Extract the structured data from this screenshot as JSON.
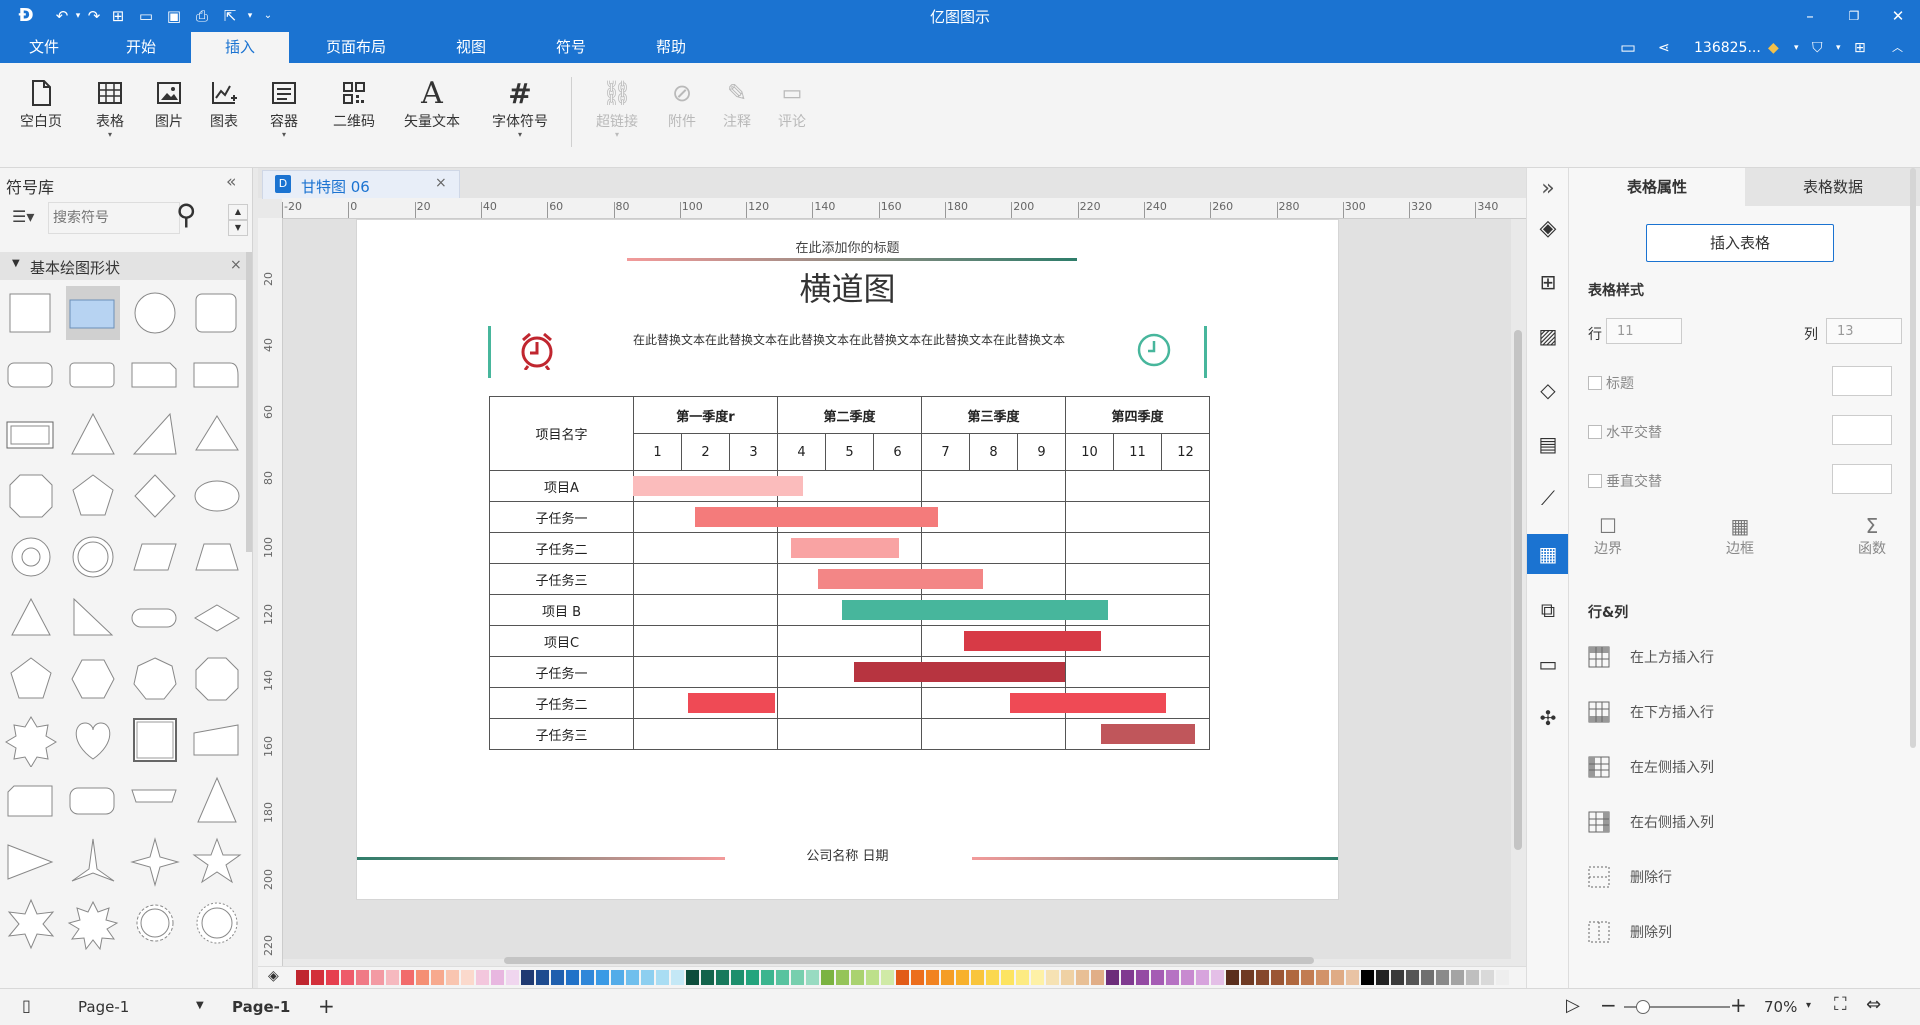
{
  "app": {
    "title": "亿图图示"
  },
  "menu": {
    "items": [
      "文件",
      "开始",
      "插入",
      "页面布局",
      "视图",
      "符号",
      "帮助"
    ],
    "active_index": 2,
    "user": "136825..."
  },
  "ribbon": {
    "items": [
      {
        "label": "空白页",
        "icon": "blank-page-icon",
        "disabled": false
      },
      {
        "label": "表格",
        "icon": "table-icon",
        "disabled": false
      },
      {
        "label": "图片",
        "icon": "image-icon",
        "disabled": false
      },
      {
        "label": "图表",
        "icon": "chart-icon",
        "disabled": false
      },
      {
        "label": "容器",
        "icon": "container-icon",
        "disabled": false
      },
      {
        "label": "二维码",
        "icon": "qr-code-icon",
        "disabled": false
      },
      {
        "label": "矢量文本",
        "icon": "vector-text-icon",
        "disabled": false
      },
      {
        "label": "字体符号",
        "icon": "font-symbol-icon",
        "disabled": false
      },
      {
        "label": "超链接",
        "icon": "hyperlink-icon",
        "disabled": true
      },
      {
        "label": "附件",
        "icon": "attachment-icon",
        "disabled": true
      },
      {
        "label": "注释",
        "icon": "annotation-icon",
        "disabled": true
      },
      {
        "label": "评论",
        "icon": "comment-icon",
        "disabled": true
      }
    ]
  },
  "library": {
    "title": "符号库",
    "search_placeholder": "搜索符号",
    "section": "基本绘图形状"
  },
  "document": {
    "tab": "甘特图 06"
  },
  "ruler": {
    "h_ticks": [
      "-20",
      "0",
      "20",
      "40",
      "60",
      "80",
      "100",
      "120",
      "140",
      "160",
      "180",
      "200",
      "220",
      "240",
      "260",
      "280",
      "300",
      "320",
      "340"
    ],
    "v_ticks": [
      "20",
      "40",
      "60",
      "80",
      "100",
      "120",
      "140",
      "160",
      "180",
      "200",
      "220"
    ]
  },
  "gantt": {
    "subtitle": "在此添加你的标题",
    "title": "横道图",
    "description": "在此替换文本在此替换文本在此替换文本在此替换文本在此替换文本在此替换文本",
    "footer": "公司名称 日期",
    "header_name": "项目名字",
    "quarters": [
      "第一季度r",
      "第二季度",
      "第三季度",
      "第四季度"
    ],
    "months": [
      "1",
      "2",
      "3",
      "4",
      "5",
      "6",
      "7",
      "8",
      "9",
      "10",
      "11",
      "12"
    ],
    "rows": [
      {
        "name": "项目A",
        "start": 1.0,
        "end": 4.55,
        "color": "#fbbcbc"
      },
      {
        "name": "子任务一",
        "start": 2.3,
        "end": 7.35,
        "color": "#f47b7b"
      },
      {
        "name": "子任务二",
        "start": 4.3,
        "end": 6.55,
        "color": "#f9a3a3"
      },
      {
        "name": "子任务三",
        "start": 4.85,
        "end": 8.3,
        "color": "#f38686"
      },
      {
        "name": "项目 B",
        "start": 5.35,
        "end": 10.9,
        "color": "#47b69c"
      },
      {
        "name": "项目C",
        "start": 7.9,
        "end": 10.75,
        "color": "#d73a46"
      },
      {
        "name": "子任务一",
        "start": 5.6,
        "end": 10.0,
        "color": "#b73440"
      },
      {
        "name": "子任务二",
        "start": 2.15,
        "end": 3.95,
        "color": "#ef4a55"
      },
      {
        "name": "子任务三",
        "start": 10.75,
        "end": 14.0,
        "color": "#c0565b"
      }
    ],
    "extra_bars": [
      {
        "row": 7,
        "start": 8.85,
        "end": 12.1,
        "color": "#ef4a55"
      }
    ]
  },
  "properties": {
    "tabs": [
      "表格属性",
      "表格数据"
    ],
    "insert_button": "插入表格",
    "style_title": "表格样式",
    "rows_label": "行",
    "rows_value": "11",
    "cols_label": "列",
    "cols_value": "13",
    "options": [
      "标题",
      "水平交替",
      "垂直交替"
    ],
    "tools": [
      "边界",
      "边框",
      "函数"
    ],
    "rowcol_title": "行&列",
    "rowcol_ops": [
      "在上方插入行",
      "在下方插入行",
      "在左侧插入列",
      "在右侧插入列",
      "删除行",
      "删除列"
    ]
  },
  "status": {
    "page_selector": "Page-1",
    "page_tab": "Page-1",
    "zoom": "70%"
  }
}
